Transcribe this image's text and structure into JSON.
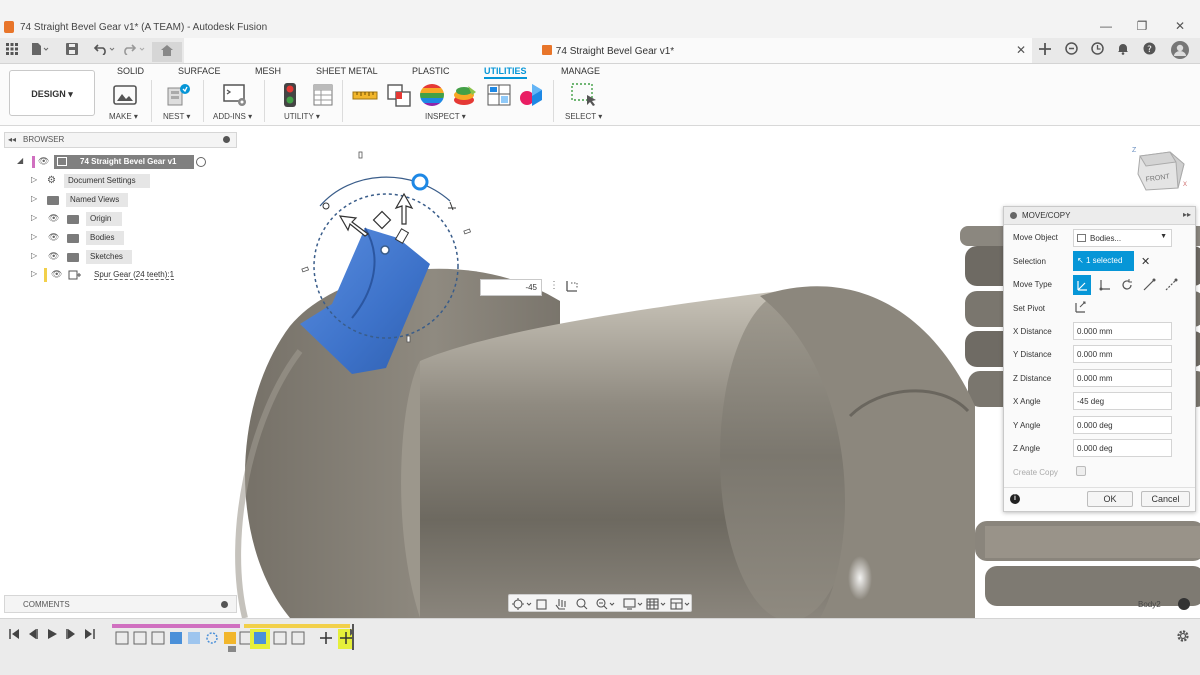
{
  "window": {
    "title": "74 Straight Bevel Gear v1* (A TEAM) - Autodesk Fusion",
    "minimize": "—",
    "maximize": "❐",
    "close": "✕"
  },
  "document_tab": {
    "title": "74 Straight Bevel Gear v1*",
    "close": "✕"
  },
  "toolbar": {
    "workspace": "DESIGN",
    "tabs": [
      "SOLID",
      "SURFACE",
      "MESH",
      "SHEET METAL",
      "PLASTIC",
      "UTILITIES",
      "MANAGE"
    ],
    "active_tab": "UTILITIES",
    "groups": [
      "MAKE",
      "NEST",
      "ADD-INS",
      "UTILITY",
      "INSPECT",
      "SELECT"
    ]
  },
  "browser": {
    "header": "BROWSER",
    "root": "74 Straight Bevel Gear v1",
    "items": [
      "Document Settings",
      "Named Views",
      "Origin",
      "Bodies",
      "Sketches",
      "Spur Gear (24 teeth):1"
    ]
  },
  "canvas": {
    "angle_input_value": "-45"
  },
  "move_copy": {
    "title": "MOVE/COPY",
    "move_object_label": "Move Object",
    "move_object_value": "Bodies...",
    "selection_label": "Selection",
    "selection_value": "1 selected",
    "move_type_label": "Move Type",
    "set_pivot_label": "Set Pivot",
    "x_distance_label": "X Distance",
    "x_distance": "0.000 mm",
    "y_distance_label": "Y Distance",
    "y_distance": "0.000 mm",
    "z_distance_label": "Z Distance",
    "z_distance": "0.000 mm",
    "x_angle_label": "X Angle",
    "x_angle": "-45 deg",
    "y_angle_label": "Y Angle",
    "y_angle": "0.000 deg",
    "z_angle_label": "Z Angle",
    "z_angle": "0.000 deg",
    "create_copy_label": "Create Copy",
    "ok": "OK",
    "cancel": "Cancel"
  },
  "comments": {
    "header": "COMMENTS"
  },
  "status": {
    "body_name": "Body2"
  },
  "viewcube": {
    "face": "FRONT",
    "axis_z": "Z",
    "axis_x": "X"
  },
  "colors": {
    "accent": "#0696d7",
    "selected_body": "#3d72c9",
    "model_gray": "#8f8a80",
    "app_orange": "#e8752a"
  }
}
